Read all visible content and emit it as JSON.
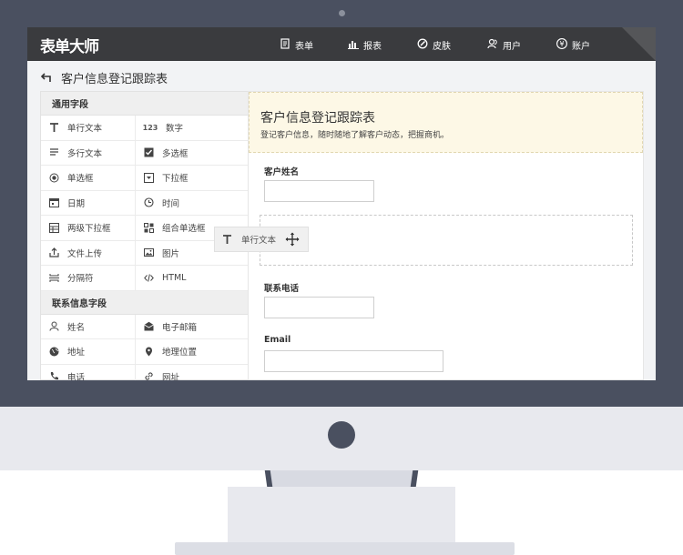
{
  "app": {
    "logo": "表单大师"
  },
  "nav": [
    {
      "label": "表单",
      "icon": "document-icon"
    },
    {
      "label": "报表",
      "icon": "bar-chart-icon"
    },
    {
      "label": "皮肤",
      "icon": "palette-icon"
    },
    {
      "label": "用户",
      "icon": "users-icon"
    },
    {
      "label": "账户",
      "icon": "yen-icon"
    }
  ],
  "page": {
    "back_icon": "back-arrow-icon",
    "title": "客户信息登记跟踪表"
  },
  "palette": {
    "groups": [
      {
        "title": "通用字段",
        "fields": [
          {
            "label": "单行文本",
            "icon": "text-icon"
          },
          {
            "label": "数字",
            "icon": "number-icon"
          },
          {
            "label": "多行文本",
            "icon": "paragraph-icon"
          },
          {
            "label": "多选框",
            "icon": "checkbox-icon"
          },
          {
            "label": "单选框",
            "icon": "radio-icon"
          },
          {
            "label": "下拉框",
            "icon": "dropdown-icon"
          },
          {
            "label": "日期",
            "icon": "calendar-icon"
          },
          {
            "label": "时间",
            "icon": "clock-icon"
          },
          {
            "label": "两级下拉框",
            "icon": "two-level-dropdown-icon"
          },
          {
            "label": "组合单选框",
            "icon": "combo-radio-icon"
          },
          {
            "label": "文件上传",
            "icon": "upload-icon"
          },
          {
            "label": "图片",
            "icon": "image-icon"
          },
          {
            "label": "分隔符",
            "icon": "divider-icon"
          },
          {
            "label": "HTML",
            "icon": "code-icon"
          }
        ]
      },
      {
        "title": "联系信息字段",
        "fields": [
          {
            "label": "姓名",
            "icon": "person-icon"
          },
          {
            "label": "电子邮箱",
            "icon": "email-icon"
          },
          {
            "label": "地址",
            "icon": "globe-icon"
          },
          {
            "label": "地理位置",
            "icon": "location-pin-icon"
          },
          {
            "label": "电话",
            "icon": "phone-icon"
          },
          {
            "label": "网址",
            "icon": "link-icon"
          }
        ]
      }
    ]
  },
  "form": {
    "title": "客户信息登记跟踪表",
    "description": "登记客户信息，随时随地了解客户动态，把握商机。",
    "fields": [
      {
        "label": "客户姓名",
        "value": ""
      },
      {
        "label": "联系电话",
        "value": ""
      },
      {
        "label": "Email",
        "value": ""
      }
    ]
  },
  "drag_ghost": {
    "label": "单行文本",
    "icon": "text-icon",
    "handle_icon": "move-icon"
  },
  "colors": {
    "topbar": "#3a3b3e",
    "bezel": "#4a5060",
    "form_header_bg": "#fdf8e6"
  }
}
